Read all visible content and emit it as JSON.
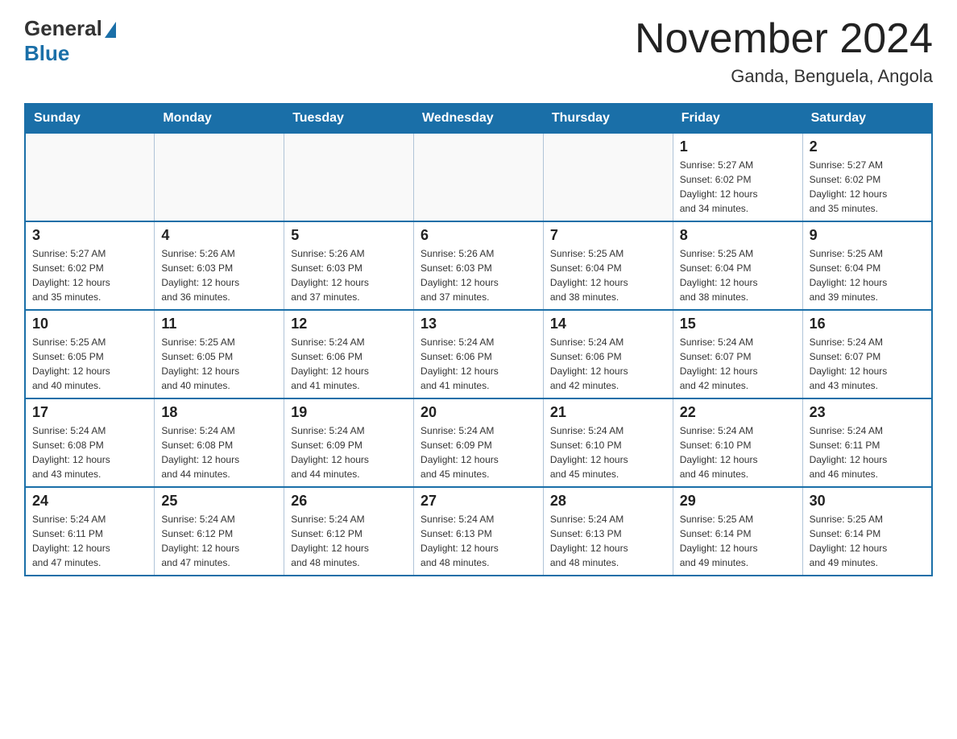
{
  "header": {
    "logo_general": "General",
    "logo_blue": "Blue",
    "month_title": "November 2024",
    "location": "Ganda, Benguela, Angola"
  },
  "weekdays": [
    "Sunday",
    "Monday",
    "Tuesday",
    "Wednesday",
    "Thursday",
    "Friday",
    "Saturday"
  ],
  "weeks": [
    [
      {
        "day": "",
        "info": ""
      },
      {
        "day": "",
        "info": ""
      },
      {
        "day": "",
        "info": ""
      },
      {
        "day": "",
        "info": ""
      },
      {
        "day": "",
        "info": ""
      },
      {
        "day": "1",
        "info": "Sunrise: 5:27 AM\nSunset: 6:02 PM\nDaylight: 12 hours\nand 34 minutes."
      },
      {
        "day": "2",
        "info": "Sunrise: 5:27 AM\nSunset: 6:02 PM\nDaylight: 12 hours\nand 35 minutes."
      }
    ],
    [
      {
        "day": "3",
        "info": "Sunrise: 5:27 AM\nSunset: 6:02 PM\nDaylight: 12 hours\nand 35 minutes."
      },
      {
        "day": "4",
        "info": "Sunrise: 5:26 AM\nSunset: 6:03 PM\nDaylight: 12 hours\nand 36 minutes."
      },
      {
        "day": "5",
        "info": "Sunrise: 5:26 AM\nSunset: 6:03 PM\nDaylight: 12 hours\nand 37 minutes."
      },
      {
        "day": "6",
        "info": "Sunrise: 5:26 AM\nSunset: 6:03 PM\nDaylight: 12 hours\nand 37 minutes."
      },
      {
        "day": "7",
        "info": "Sunrise: 5:25 AM\nSunset: 6:04 PM\nDaylight: 12 hours\nand 38 minutes."
      },
      {
        "day": "8",
        "info": "Sunrise: 5:25 AM\nSunset: 6:04 PM\nDaylight: 12 hours\nand 38 minutes."
      },
      {
        "day": "9",
        "info": "Sunrise: 5:25 AM\nSunset: 6:04 PM\nDaylight: 12 hours\nand 39 minutes."
      }
    ],
    [
      {
        "day": "10",
        "info": "Sunrise: 5:25 AM\nSunset: 6:05 PM\nDaylight: 12 hours\nand 40 minutes."
      },
      {
        "day": "11",
        "info": "Sunrise: 5:25 AM\nSunset: 6:05 PM\nDaylight: 12 hours\nand 40 minutes."
      },
      {
        "day": "12",
        "info": "Sunrise: 5:24 AM\nSunset: 6:06 PM\nDaylight: 12 hours\nand 41 minutes."
      },
      {
        "day": "13",
        "info": "Sunrise: 5:24 AM\nSunset: 6:06 PM\nDaylight: 12 hours\nand 41 minutes."
      },
      {
        "day": "14",
        "info": "Sunrise: 5:24 AM\nSunset: 6:06 PM\nDaylight: 12 hours\nand 42 minutes."
      },
      {
        "day": "15",
        "info": "Sunrise: 5:24 AM\nSunset: 6:07 PM\nDaylight: 12 hours\nand 42 minutes."
      },
      {
        "day": "16",
        "info": "Sunrise: 5:24 AM\nSunset: 6:07 PM\nDaylight: 12 hours\nand 43 minutes."
      }
    ],
    [
      {
        "day": "17",
        "info": "Sunrise: 5:24 AM\nSunset: 6:08 PM\nDaylight: 12 hours\nand 43 minutes."
      },
      {
        "day": "18",
        "info": "Sunrise: 5:24 AM\nSunset: 6:08 PM\nDaylight: 12 hours\nand 44 minutes."
      },
      {
        "day": "19",
        "info": "Sunrise: 5:24 AM\nSunset: 6:09 PM\nDaylight: 12 hours\nand 44 minutes."
      },
      {
        "day": "20",
        "info": "Sunrise: 5:24 AM\nSunset: 6:09 PM\nDaylight: 12 hours\nand 45 minutes."
      },
      {
        "day": "21",
        "info": "Sunrise: 5:24 AM\nSunset: 6:10 PM\nDaylight: 12 hours\nand 45 minutes."
      },
      {
        "day": "22",
        "info": "Sunrise: 5:24 AM\nSunset: 6:10 PM\nDaylight: 12 hours\nand 46 minutes."
      },
      {
        "day": "23",
        "info": "Sunrise: 5:24 AM\nSunset: 6:11 PM\nDaylight: 12 hours\nand 46 minutes."
      }
    ],
    [
      {
        "day": "24",
        "info": "Sunrise: 5:24 AM\nSunset: 6:11 PM\nDaylight: 12 hours\nand 47 minutes."
      },
      {
        "day": "25",
        "info": "Sunrise: 5:24 AM\nSunset: 6:12 PM\nDaylight: 12 hours\nand 47 minutes."
      },
      {
        "day": "26",
        "info": "Sunrise: 5:24 AM\nSunset: 6:12 PM\nDaylight: 12 hours\nand 48 minutes."
      },
      {
        "day": "27",
        "info": "Sunrise: 5:24 AM\nSunset: 6:13 PM\nDaylight: 12 hours\nand 48 minutes."
      },
      {
        "day": "28",
        "info": "Sunrise: 5:24 AM\nSunset: 6:13 PM\nDaylight: 12 hours\nand 48 minutes."
      },
      {
        "day": "29",
        "info": "Sunrise: 5:25 AM\nSunset: 6:14 PM\nDaylight: 12 hours\nand 49 minutes."
      },
      {
        "day": "30",
        "info": "Sunrise: 5:25 AM\nSunset: 6:14 PM\nDaylight: 12 hours\nand 49 minutes."
      }
    ]
  ]
}
